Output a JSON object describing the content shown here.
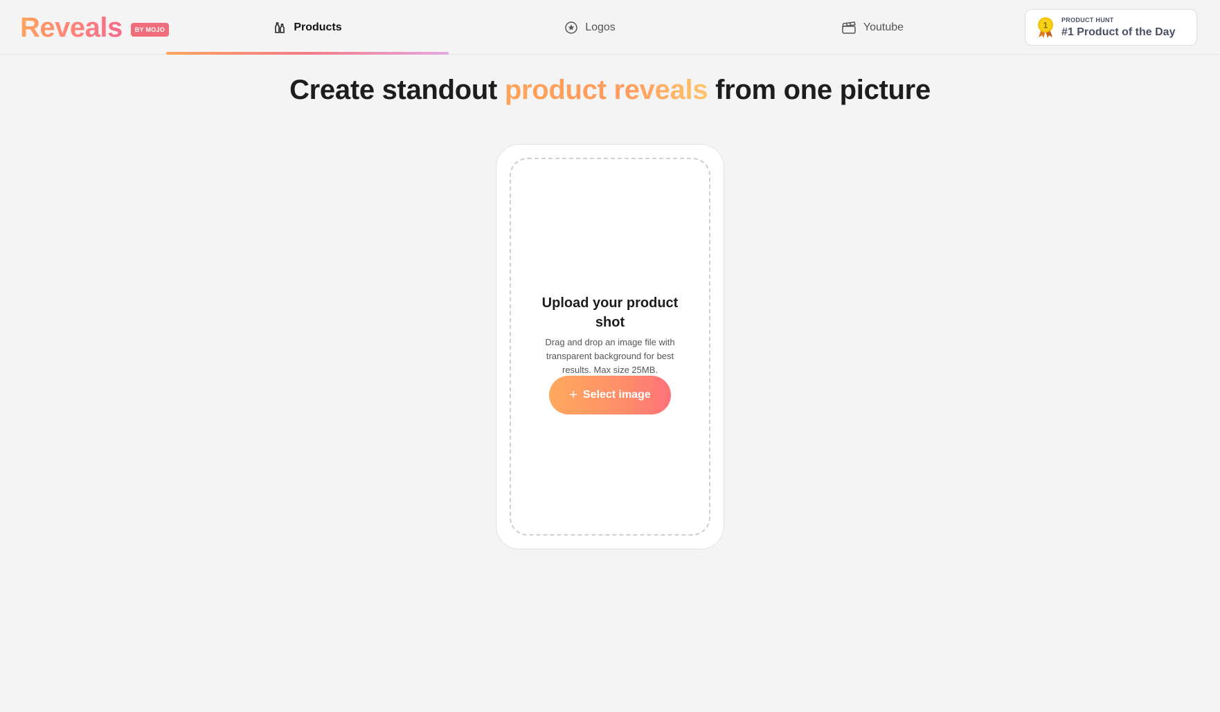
{
  "brand": {
    "name": "Reveals",
    "badge": "BY MOJO"
  },
  "tabs": [
    {
      "label": "Products",
      "icon": "bottles-icon",
      "active": true
    },
    {
      "label": "Logos",
      "icon": "star-circle-icon",
      "active": false
    },
    {
      "label": "Youtube",
      "icon": "clapperboard-icon",
      "active": false
    }
  ],
  "product_hunt": {
    "eyebrow": "PRODUCT HUNT",
    "title": "#1 Product of the Day",
    "medal_number": "1"
  },
  "headline": {
    "part1": "Create standout ",
    "accent": "product reveals",
    "part2": " from one picture"
  },
  "upload": {
    "title": "Upload your product shot",
    "description": "Drag and drop an image file with transparent background for best results. Max size 25MB.",
    "button_label": "Select image"
  },
  "colors": {
    "accent_orange": "#ffa35a",
    "accent_pink": "#f56b8a",
    "background": "#f4f4f4"
  }
}
